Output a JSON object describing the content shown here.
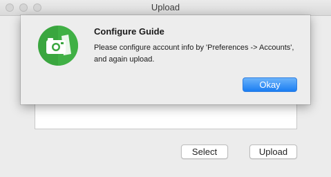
{
  "window": {
    "title": "Upload"
  },
  "main": {
    "select_label": "Select",
    "upload_label": "Upload"
  },
  "dialog": {
    "title": "Configure Guide",
    "message": "Please configure account info by 'Preferences -> Accounts', and again upload.",
    "okay_label": "Okay",
    "icon": "green-camera-app-icon",
    "accent_color": "#3aa63f",
    "button_color": "#1a7df2"
  }
}
